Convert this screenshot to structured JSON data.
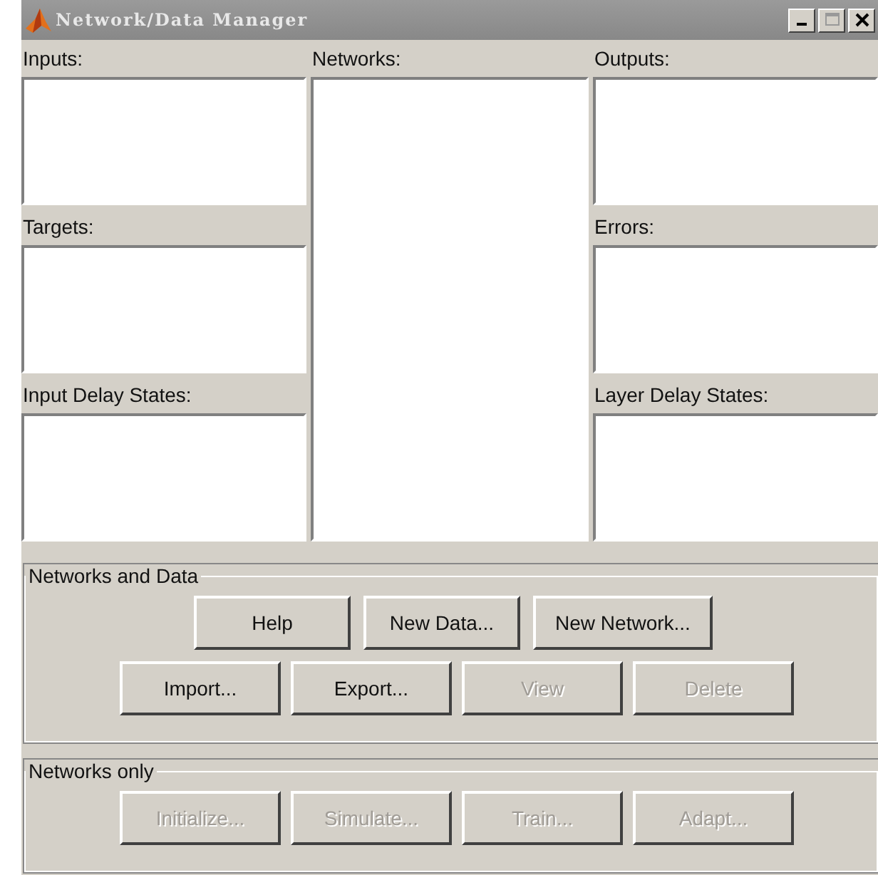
{
  "window": {
    "title": "Network/Data Manager"
  },
  "columns": [
    {
      "lists": [
        {
          "label": "Inputs:"
        },
        {
          "label": "Targets:"
        },
        {
          "label": "Input Delay States:"
        }
      ]
    },
    {
      "lists": [
        {
          "label": "Networks:"
        }
      ]
    },
    {
      "lists": [
        {
          "label": "Outputs:"
        },
        {
          "label": "Errors:"
        },
        {
          "label": "Layer Delay States:"
        }
      ]
    }
  ],
  "groups": [
    {
      "title": "Networks and Data",
      "rows": [
        [
          {
            "label": "Help",
            "disabled": false
          },
          {
            "label": "New Data...",
            "disabled": false
          },
          {
            "label": "New Network...",
            "disabled": false
          }
        ],
        [
          {
            "label": "Import...",
            "disabled": false
          },
          {
            "label": "Export...",
            "disabled": false
          },
          {
            "label": "View",
            "disabled": true
          },
          {
            "label": "Delete",
            "disabled": true
          }
        ]
      ]
    },
    {
      "title": "Networks only",
      "rows": [
        [
          {
            "label": "Initialize...",
            "disabled": true
          },
          {
            "label": "Simulate...",
            "disabled": true
          },
          {
            "label": "Train...",
            "disabled": true
          },
          {
            "label": "Adapt...",
            "disabled": true
          }
        ]
      ]
    }
  ]
}
